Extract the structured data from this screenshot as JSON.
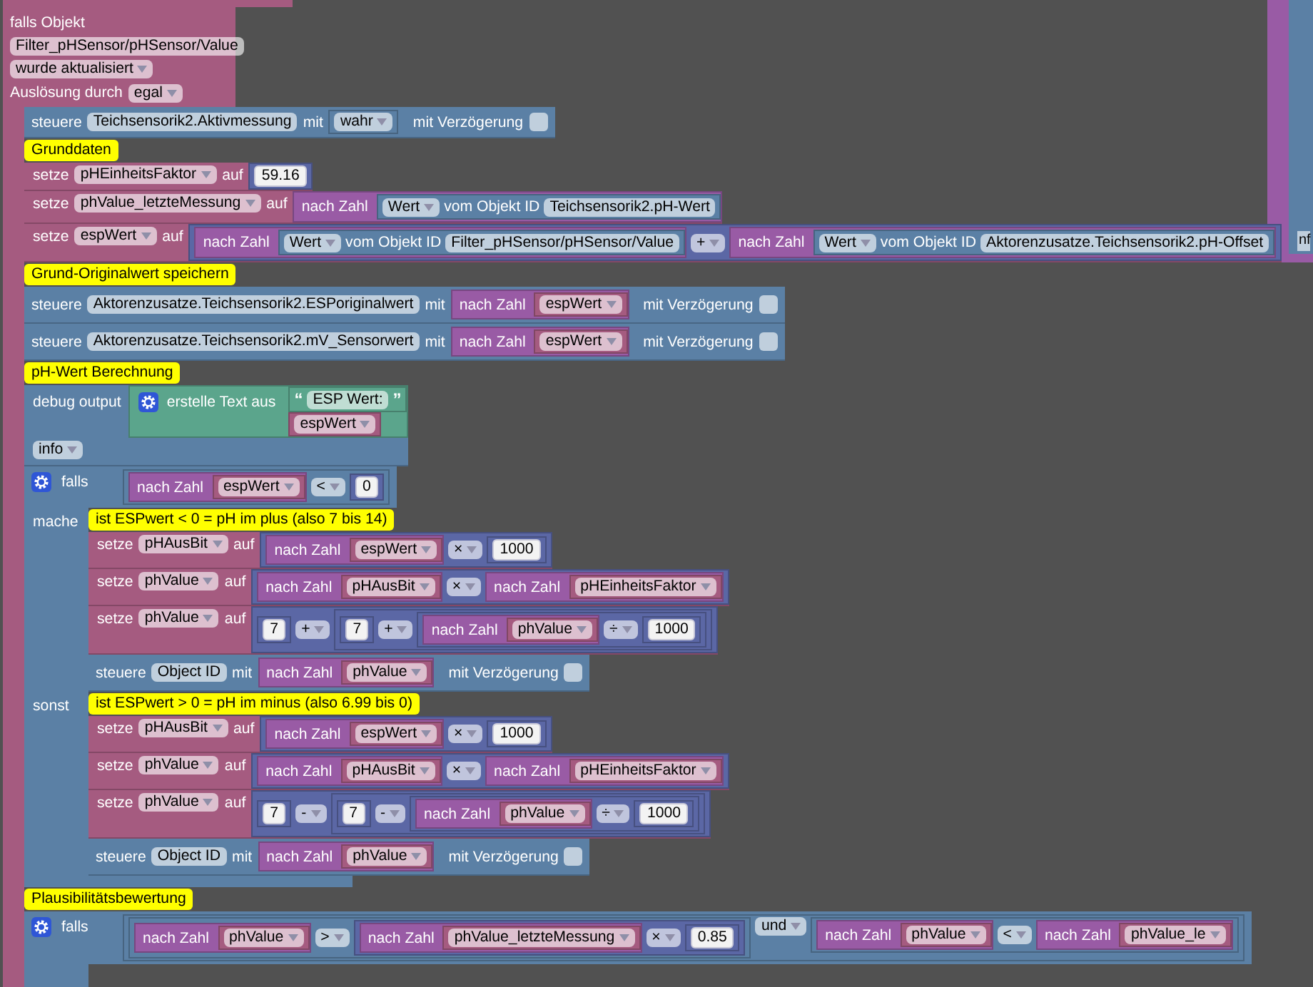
{
  "trigger": {
    "label": "falls Objekt",
    "object": "Filter_pHSensor/pHSensor/Value",
    "event": "wurde aktualisiert",
    "trigger_label": "Auslösung durch",
    "trigger_value": "egal",
    "statements": [
      {
        "kind": "control",
        "label": "steuere",
        "id": "Teichsensorik2.Aktivmessung",
        "with": "mit",
        "value": {
          "kind": "bool",
          "value": "wahr"
        },
        "delay_label": "mit Verzögerung",
        "delay": false
      },
      {
        "kind": "comment",
        "text": "Grunddaten"
      },
      {
        "kind": "set",
        "label": "setze",
        "var": "pHEinheitsFaktor",
        "to": "auf",
        "value": {
          "kind": "number",
          "value": "59.16"
        }
      },
      {
        "kind": "set",
        "label": "setze",
        "var": "phValue_letzteMessung",
        "to": "auf",
        "value": {
          "kind": "to_number",
          "label": "nach Zahl",
          "value": {
            "kind": "get_state",
            "prop": "Wert",
            "label": "vom Objekt ID",
            "id": "Teichsensorik2.pH-Wert"
          }
        }
      },
      {
        "kind": "set",
        "label": "setze",
        "var": "espWert",
        "to": "auf",
        "value": {
          "kind": "arith",
          "a": {
            "kind": "to_number",
            "label": "nach Zahl",
            "value": {
              "kind": "get_state",
              "prop": "Wert",
              "label": "vom Objekt ID",
              "id": "Filter_pHSensor/pHSensor/Value"
            }
          },
          "op": "+",
          "b": {
            "kind": "to_number",
            "label": "nach Zahl",
            "value": {
              "kind": "get_state",
              "prop": "Wert",
              "label": "vom Objekt ID",
              "id": "Aktorenzusatze.Teichsensorik2.pH-Offset"
            }
          }
        }
      },
      {
        "kind": "comment",
        "text": "Grund-Originalwert speichern"
      },
      {
        "kind": "control",
        "label": "steuere",
        "id": "Aktorenzusatze.Teichsensorik2.ESPoriginalwert",
        "with": "mit",
        "value": {
          "kind": "to_number",
          "label": "nach Zahl",
          "value": {
            "kind": "var",
            "name": "espWert"
          }
        },
        "delay_label": "mit Verzögerung",
        "delay": false
      },
      {
        "kind": "control",
        "label": "steuere",
        "id": "Aktorenzusatze.Teichsensorik2.mV_Sensorwert",
        "with": "mit",
        "value": {
          "kind": "to_number",
          "label": "nach Zahl",
          "value": {
            "kind": "var",
            "name": "espWert"
          }
        },
        "delay_label": "mit Verzögerung",
        "delay": false
      },
      {
        "kind": "comment",
        "text": "pH-Wert Berechnung"
      },
      {
        "kind": "debug",
        "label": "debug output",
        "value": {
          "kind": "join",
          "label": "erstelle Text aus",
          "items": [
            {
              "kind": "text",
              "open": "“",
              "text": "ESP Wert:",
              "close": "”"
            },
            {
              "kind": "var",
              "name": "espWert"
            }
          ]
        },
        "level": "info"
      },
      {
        "kind": "if",
        "label": "falls",
        "cond": {
          "kind": "compare",
          "a": {
            "kind": "to_number",
            "label": "nach Zahl",
            "value": {
              "kind": "var",
              "name": "espWert"
            }
          },
          "op": "<",
          "b": {
            "kind": "number",
            "value": "0"
          }
        },
        "then_label": "mache",
        "then": [
          {
            "kind": "comment",
            "text": "ist ESPwert < 0 = pH im plus (also 7 bis 14)"
          },
          {
            "kind": "set",
            "label": "setze",
            "var": "pHAusBit",
            "to": "auf",
            "value": {
              "kind": "arith",
              "a": {
                "kind": "to_number",
                "label": "nach Zahl",
                "value": {
                  "kind": "var",
                  "name": "espWert"
                }
              },
              "op": "×",
              "b": {
                "kind": "number",
                "value": "1000"
              }
            }
          },
          {
            "kind": "set",
            "label": "setze",
            "var": "phValue",
            "to": "auf",
            "value": {
              "kind": "arith",
              "a": {
                "kind": "to_number",
                "label": "nach Zahl",
                "value": {
                  "kind": "var",
                  "name": "pHAusBit"
                }
              },
              "op": "×",
              "b": {
                "kind": "to_number",
                "label": "nach Zahl",
                "value": {
                  "kind": "var",
                  "name": "pHEinheitsFaktor"
                }
              }
            }
          },
          {
            "kind": "set",
            "label": "setze",
            "var": "phValue",
            "to": "auf",
            "value": {
              "kind": "arith",
              "a": {
                "kind": "number",
                "value": "7"
              },
              "op": "+",
              "b": {
                "kind": "arith",
                "a": {
                  "kind": "number",
                  "value": "7"
                },
                "op": "+",
                "b": {
                  "kind": "arith",
                  "a": {
                    "kind": "to_number",
                    "label": "nach Zahl",
                    "value": {
                      "kind": "var",
                      "name": "phValue"
                    }
                  },
                  "op": "÷",
                  "b": {
                    "kind": "number",
                    "value": "1000"
                  }
                }
              }
            }
          },
          {
            "kind": "control",
            "label": "steuere",
            "id": "Object ID",
            "with": "mit",
            "value": {
              "kind": "to_number",
              "label": "nach Zahl",
              "value": {
                "kind": "var",
                "name": "phValue"
              }
            },
            "delay_label": "mit Verzögerung",
            "delay": false
          }
        ],
        "else_label": "sonst",
        "else": [
          {
            "kind": "comment",
            "text": "ist ESPwert > 0 = pH im minus (also 6.99 bis 0)"
          },
          {
            "kind": "set",
            "label": "setze",
            "var": "pHAusBit",
            "to": "auf",
            "value": {
              "kind": "arith",
              "a": {
                "kind": "to_number",
                "label": "nach Zahl",
                "value": {
                  "kind": "var",
                  "name": "espWert"
                }
              },
              "op": "×",
              "b": {
                "kind": "number",
                "value": "1000"
              }
            }
          },
          {
            "kind": "set",
            "label": "setze",
            "var": "phValue",
            "to": "auf",
            "value": {
              "kind": "arith",
              "a": {
                "kind": "to_number",
                "label": "nach Zahl",
                "value": {
                  "kind": "var",
                  "name": "pHAusBit"
                }
              },
              "op": "×",
              "b": {
                "kind": "to_number",
                "label": "nach Zahl",
                "value": {
                  "kind": "var",
                  "name": "pHEinheitsFaktor"
                }
              }
            }
          },
          {
            "kind": "set",
            "label": "setze",
            "var": "phValue",
            "to": "auf",
            "value": {
              "kind": "arith",
              "a": {
                "kind": "number",
                "value": "7"
              },
              "op": "-",
              "b": {
                "kind": "arith",
                "a": {
                  "kind": "number",
                  "value": "7"
                },
                "op": "-",
                "b": {
                  "kind": "arith",
                  "a": {
                    "kind": "to_number",
                    "label": "nach Zahl",
                    "value": {
                      "kind": "var",
                      "name": "phValue"
                    }
                  },
                  "op": "÷",
                  "b": {
                    "kind": "number",
                    "value": "1000"
                  }
                }
              }
            }
          },
          {
            "kind": "control",
            "label": "steuere",
            "id": "Object ID",
            "with": "mit",
            "value": {
              "kind": "to_number",
              "label": "nach Zahl",
              "value": {
                "kind": "var",
                "name": "phValue"
              }
            },
            "delay_label": "mit Verzögerung",
            "delay": false
          }
        ]
      },
      {
        "kind": "comment",
        "text": "Plausibilitätsbewertung"
      },
      {
        "kind": "if",
        "label": "falls",
        "cond": {
          "kind": "logic",
          "a": {
            "kind": "compare",
            "a": {
              "kind": "to_number",
              "label": "nach Zahl",
              "value": {
                "kind": "var",
                "name": "phValue"
              }
            },
            "op": ">",
            "b": {
              "kind": "arith",
              "a": {
                "kind": "to_number",
                "label": "nach Zahl",
                "value": {
                  "kind": "var",
                  "name": "phValue_letzteMessung"
                }
              },
              "op": "×",
              "b": {
                "kind": "number",
                "value": "0.85"
              }
            }
          },
          "op": "und",
          "b": {
            "kind": "compare",
            "a": {
              "kind": "to_number",
              "label": "nach Zahl",
              "value": {
                "kind": "var",
                "name": "phValue"
              }
            },
            "op": "<",
            "b": {
              "kind": "to_number",
              "label": "nach Zahl",
              "value": {
                "kind": "var",
                "name": "phValue_le"
              }
            }
          }
        }
      }
    ]
  },
  "side_block": {
    "field": "nf"
  }
}
